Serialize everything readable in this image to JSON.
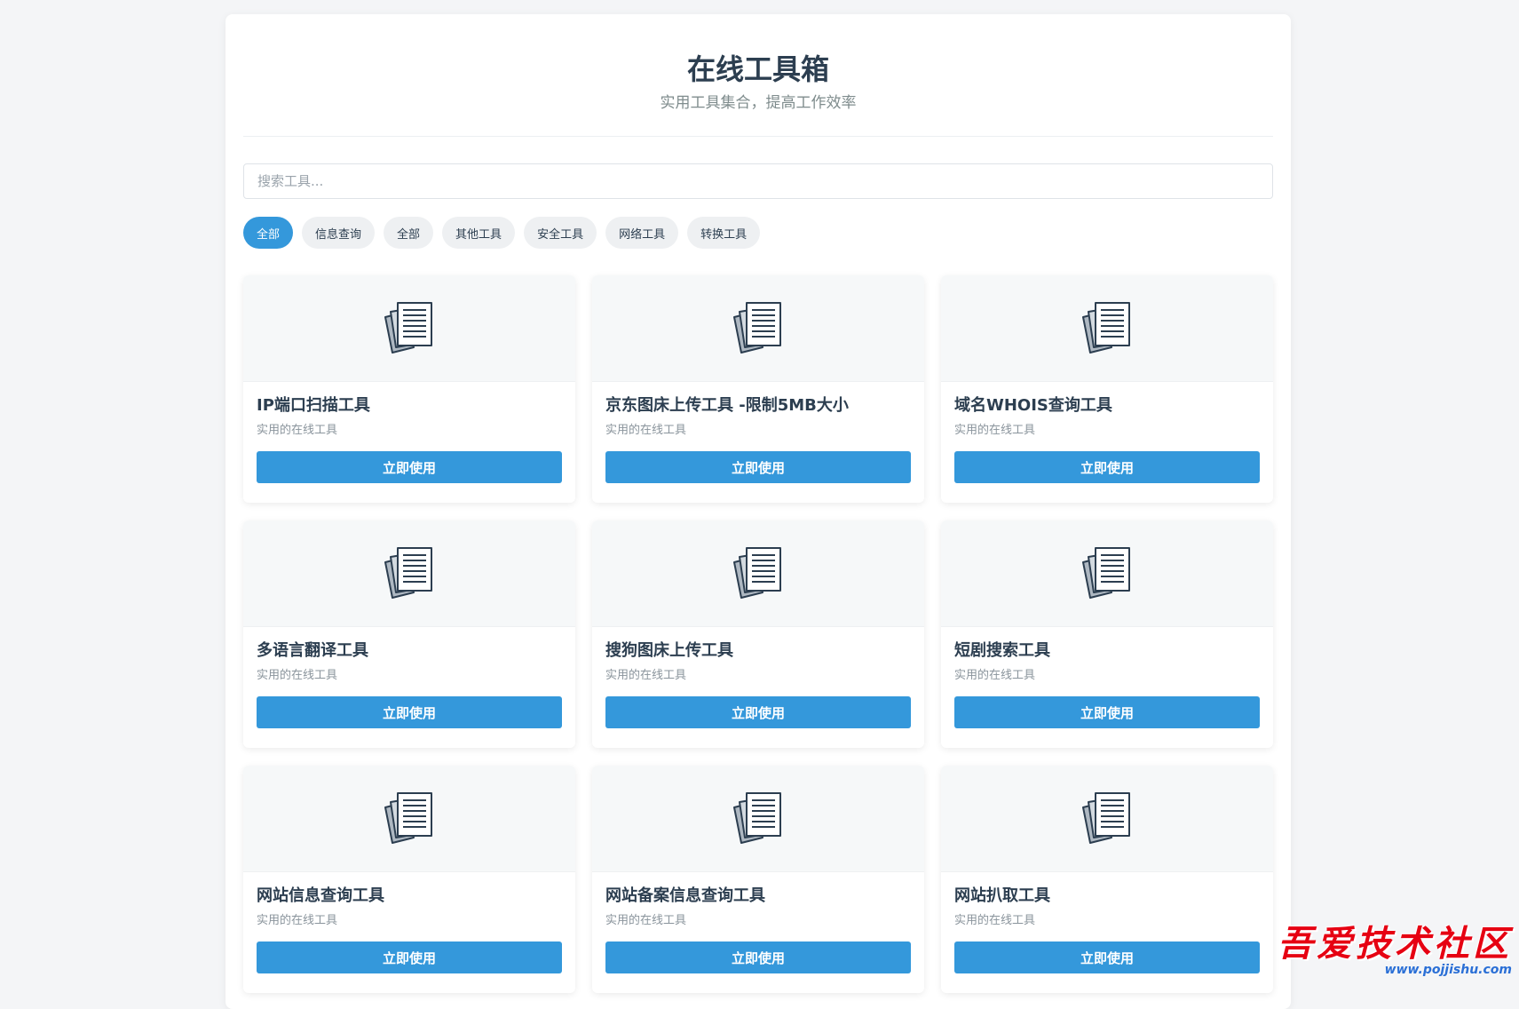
{
  "header": {
    "title": "在线工具箱",
    "subtitle": "实用工具集合，提高工作效率"
  },
  "search": {
    "placeholder": "搜索工具..."
  },
  "filters": [
    {
      "label": "全部",
      "active": true
    },
    {
      "label": "信息查询",
      "active": false
    },
    {
      "label": "全部",
      "active": false
    },
    {
      "label": "其他工具",
      "active": false
    },
    {
      "label": "安全工具",
      "active": false
    },
    {
      "label": "网络工具",
      "active": false
    },
    {
      "label": "转换工具",
      "active": false
    }
  ],
  "tools": [
    {
      "title": "IP端口扫描工具",
      "desc": "实用的在线工具",
      "button": "立即使用",
      "icon": "documents-icon"
    },
    {
      "title": "京东图床上传工具 -限制5MB大小",
      "desc": "实用的在线工具",
      "button": "立即使用",
      "icon": "documents-icon"
    },
    {
      "title": "域名WHOIS查询工具",
      "desc": "实用的在线工具",
      "button": "立即使用",
      "icon": "documents-icon"
    },
    {
      "title": "多语言翻译工具",
      "desc": "实用的在线工具",
      "button": "立即使用",
      "icon": "documents-icon"
    },
    {
      "title": "搜狗图床上传工具",
      "desc": "实用的在线工具",
      "button": "立即使用",
      "icon": "documents-icon"
    },
    {
      "title": "短剧搜索工具",
      "desc": "实用的在线工具",
      "button": "立即使用",
      "icon": "documents-icon"
    },
    {
      "title": "网站信息查询工具",
      "desc": "实用的在线工具",
      "button": "立即使用",
      "icon": "documents-icon"
    },
    {
      "title": "网站备案信息查询工具",
      "desc": "实用的在线工具",
      "button": "立即使用",
      "icon": "documents-icon"
    },
    {
      "title": "网站扒取工具",
      "desc": "实用的在线工具",
      "button": "立即使用",
      "icon": "documents-icon"
    }
  ],
  "watermark": {
    "text": "吾爱技术社区",
    "url": "www.pojjishu.com"
  },
  "colors": {
    "accent": "#3498db",
    "title": "#2c3e50",
    "watermark": "#e60012"
  }
}
